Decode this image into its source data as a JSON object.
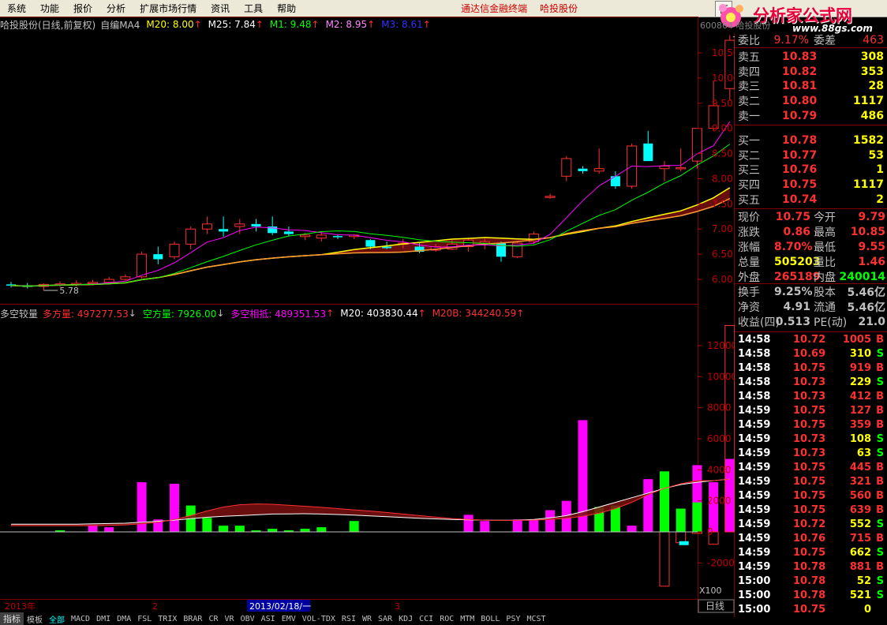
{
  "menu": {
    "items": [
      "系统",
      "功能",
      "报价",
      "分析",
      "扩展市场行情",
      "资讯",
      "工具",
      "帮助"
    ],
    "brand_left": "通达信金融终端",
    "brand_right": "哈投股份",
    "right_tab": "行"
  },
  "logo": {
    "text": "分析家公式网",
    "url": "www.88gs.com"
  },
  "chart_title": {
    "stock": "哈投股份(日线,前复权)",
    "indicator": "自编MA4",
    "m20": "M20: 8.00",
    "m25": "M25: 7.84",
    "m1": "M1: 9.48",
    "m2": "M2: 8.95",
    "m3": "M3: 8.61",
    "code_overlay": "600864 哈投股份"
  },
  "price_axis": [
    "10.50",
    "10.00",
    "9.50",
    "9.00",
    "8.50",
    "8.00",
    "7.50",
    "7.00",
    "6.50",
    "6.00"
  ],
  "high_label": "10.85",
  "low_label": "5.78",
  "volume_title": {
    "name": "多空较量",
    "long": "多方量: 497277.53",
    "short": "空方量: 7926.00",
    "diff": "多空相抵: 489351.53",
    "m20": "M20: 403830.44",
    "m20b": "M20B: 344240.59"
  },
  "volume_axis": [
    "12000",
    "10000",
    "8000",
    "6000",
    "4000",
    "2000",
    "0",
    "-2000"
  ],
  "volume_unit": "X100",
  "period": "日线",
  "x_axis": {
    "year": "2013年",
    "feb": "2",
    "cursor_date": "2013/02/18/一",
    "mar": "3"
  },
  "bottom_tabs": [
    "指标",
    "模板",
    "全部",
    "MACD",
    "DMI",
    "DMA",
    "FSL",
    "TRIX",
    "BRAR",
    "CR",
    "VR",
    "OBV",
    "ASI",
    "EMV",
    "VOL-TDX",
    "RSI",
    "WR",
    "SAR",
    "KDJ",
    "CCI",
    "ROC",
    "MTM",
    "BOLL",
    "PSY",
    "MCST"
  ],
  "colors": {
    "up": "#ff3030",
    "down": "#00ffff",
    "long": "#ff00ff",
    "short": "#00ff00",
    "text": "#c0c0c0",
    "yellow": "#ffff00"
  },
  "quote": {
    "weibi": {
      "label": "委比",
      "value": "9.17%"
    },
    "weicha": {
      "label": "委差",
      "value": "463"
    },
    "sell": [
      {
        "label": "卖五",
        "price": "10.83",
        "vol": "308"
      },
      {
        "label": "卖四",
        "price": "10.82",
        "vol": "353"
      },
      {
        "label": "卖三",
        "price": "10.81",
        "vol": "28"
      },
      {
        "label": "卖二",
        "price": "10.80",
        "vol": "1117"
      },
      {
        "label": "卖一",
        "price": "10.79",
        "vol": "486"
      }
    ],
    "buy": [
      {
        "label": "买一",
        "price": "10.78",
        "vol": "1582"
      },
      {
        "label": "买二",
        "price": "10.77",
        "vol": "53"
      },
      {
        "label": "买三",
        "price": "10.76",
        "vol": "1"
      },
      {
        "label": "买四",
        "price": "10.75",
        "vol": "1117"
      },
      {
        "label": "买五",
        "price": "10.74",
        "vol": "2"
      }
    ],
    "stats": [
      {
        "l1": "现价",
        "v1": "10.75",
        "l2": "今开",
        "v2": "9.79",
        "c1": "#ff3030",
        "c2": "#ff3030"
      },
      {
        "l1": "涨跌",
        "v1": "0.86",
        "l2": "最高",
        "v2": "10.85",
        "c1": "#ff3030",
        "c2": "#ff3030"
      },
      {
        "l1": "涨幅",
        "v1": "8.70%",
        "l2": "最低",
        "v2": "9.55",
        "c1": "#ff3030",
        "c2": "#ff3030"
      },
      {
        "l1": "总量",
        "v1": "505203",
        "l2": "量比",
        "v2": "1.46",
        "c1": "#ffff00",
        "c2": "#ff3030"
      },
      {
        "l1": "外盘",
        "v1": "265189",
        "l2": "内盘",
        "v2": "240014",
        "c1": "#ff3030",
        "c2": "#00ff00"
      },
      {
        "l1": "换手",
        "v1": "9.25%",
        "l2": "股本",
        "v2": "5.46亿",
        "c1": "#c0c0c0",
        "c2": "#c0c0c0"
      },
      {
        "l1": "净资",
        "v1": "4.91",
        "l2": "流通",
        "v2": "5.46亿",
        "c1": "#c0c0c0",
        "c2": "#c0c0c0"
      },
      {
        "l1": "收益(四)",
        "v1": "0.513",
        "l2": "PE(动)",
        "v2": "21.0",
        "c1": "#c0c0c0",
        "c2": "#c0c0c0"
      }
    ],
    "ticks": [
      {
        "time": "14:58",
        "price": "10.72",
        "vol": "1005",
        "bs": "B"
      },
      {
        "time": "14:58",
        "price": "10.69",
        "vol": "310",
        "bs": "S"
      },
      {
        "time": "14:58",
        "price": "10.75",
        "vol": "919",
        "bs": "B"
      },
      {
        "time": "14:58",
        "price": "10.73",
        "vol": "229",
        "bs": "S"
      },
      {
        "time": "14:58",
        "price": "10.73",
        "vol": "412",
        "bs": "B"
      },
      {
        "time": "14:59",
        "price": "10.75",
        "vol": "127",
        "bs": "B"
      },
      {
        "time": "14:59",
        "price": "10.75",
        "vol": "359",
        "bs": "B"
      },
      {
        "time": "14:59",
        "price": "10.73",
        "vol": "108",
        "bs": "S"
      },
      {
        "time": "14:59",
        "price": "10.73",
        "vol": "63",
        "bs": "S"
      },
      {
        "time": "14:59",
        "price": "10.75",
        "vol": "445",
        "bs": "B"
      },
      {
        "time": "14:59",
        "price": "10.75",
        "vol": "321",
        "bs": "B"
      },
      {
        "time": "14:59",
        "price": "10.75",
        "vol": "560",
        "bs": "B"
      },
      {
        "time": "14:59",
        "price": "10.75",
        "vol": "639",
        "bs": "B"
      },
      {
        "time": "14:59",
        "price": "10.72",
        "vol": "552",
        "bs": "S"
      },
      {
        "time": "14:59",
        "price": "10.76",
        "vol": "715",
        "bs": "B"
      },
      {
        "time": "14:59",
        "price": "10.75",
        "vol": "662",
        "bs": "S"
      },
      {
        "time": "14:59",
        "price": "10.78",
        "vol": "881",
        "bs": "B"
      },
      {
        "time": "15:00",
        "price": "10.78",
        "vol": "52",
        "bs": "S"
      },
      {
        "time": "15:00",
        "price": "10.78",
        "vol": "521",
        "bs": "S"
      },
      {
        "time": "15:00",
        "price": "10.75",
        "vol": "0",
        "bs": ""
      }
    ]
  },
  "chart_data": [
    {
      "type": "candlestick",
      "title": "哈投股份(日线,前复权)",
      "ylim": [
        5.78,
        10.85
      ],
      "ohlc": [
        [
          5.9,
          5.95,
          5.84,
          5.88
        ],
        [
          5.88,
          5.93,
          5.82,
          5.85
        ],
        [
          5.86,
          5.92,
          5.78,
          5.9
        ],
        [
          5.9,
          5.96,
          5.85,
          5.91
        ],
        [
          5.91,
          5.98,
          5.86,
          5.92
        ],
        [
          5.92,
          5.99,
          5.88,
          5.94
        ],
        [
          5.94,
          6.05,
          5.9,
          6.0
        ],
        [
          6.0,
          6.1,
          5.98,
          6.05
        ],
        [
          6.05,
          6.55,
          6.02,
          6.5
        ],
        [
          6.5,
          6.65,
          6.3,
          6.4
        ],
        [
          6.45,
          6.75,
          6.4,
          6.7
        ],
        [
          6.7,
          7.05,
          6.6,
          7.0
        ],
        [
          7.0,
          7.25,
          6.9,
          7.1
        ],
        [
          7.0,
          7.25,
          6.85,
          6.95
        ],
        [
          7.05,
          7.2,
          6.9,
          7.1
        ],
        [
          7.1,
          7.2,
          6.95,
          7.05
        ],
        [
          7.05,
          7.25,
          6.88,
          6.92
        ],
        [
          6.95,
          7.05,
          6.85,
          6.9
        ],
        [
          6.85,
          6.92,
          6.78,
          6.88
        ],
        [
          6.82,
          6.95,
          6.75,
          6.88
        ],
        [
          6.86,
          6.9,
          6.8,
          6.85
        ],
        [
          6.85,
          6.9,
          6.8,
          6.88
        ],
        [
          6.78,
          6.8,
          6.6,
          6.65
        ],
        [
          6.65,
          6.75,
          6.6,
          6.62
        ],
        [
          6.7,
          6.8,
          6.62,
          6.72
        ],
        [
          6.65,
          6.72,
          6.52,
          6.55
        ],
        [
          6.58,
          6.7,
          6.55,
          6.65
        ],
        [
          6.6,
          6.78,
          6.58,
          6.7
        ],
        [
          6.65,
          6.82,
          6.55,
          6.78
        ],
        [
          6.72,
          6.8,
          6.6,
          6.75
        ],
        [
          6.72,
          6.75,
          6.35,
          6.45
        ],
        [
          6.45,
          6.75,
          6.42,
          6.72
        ],
        [
          6.75,
          6.95,
          6.7,
          6.9
        ],
        [
          7.65,
          7.7,
          7.6,
          7.65
        ],
        [
          8.05,
          8.45,
          7.95,
          8.4
        ],
        [
          8.2,
          8.25,
          8.1,
          8.15
        ],
        [
          8.15,
          8.6,
          8.1,
          8.2
        ],
        [
          8.05,
          8.15,
          7.8,
          7.85
        ],
        [
          7.85,
          8.7,
          7.8,
          8.65
        ],
        [
          8.7,
          8.95,
          8.4,
          8.35
        ],
        [
          8.2,
          8.35,
          7.95,
          8.25
        ],
        [
          8.2,
          8.6,
          8.15,
          8.22
        ],
        [
          8.35,
          9.0,
          8.2,
          9.0
        ],
        [
          9.0,
          9.95,
          8.95,
          9.45
        ],
        [
          9.79,
          10.85,
          9.55,
          10.75
        ]
      ],
      "ma": {
        "M20": "8.00",
        "M25": "7.84",
        "M1": "9.48",
        "M2": "8.95",
        "M3": "8.61"
      }
    },
    {
      "type": "bar",
      "title": "多空较量",
      "unit": "X100",
      "ylim": [
        -3500,
        13500
      ],
      "series": [
        {
          "name": "多方量",
          "values": [
            0,
            0,
            0,
            0,
            0,
            500,
            300,
            0,
            3200,
            800,
            3100,
            0,
            0,
            0,
            0,
            0,
            0,
            0,
            0,
            0,
            0,
            0,
            0,
            0,
            0,
            0,
            0,
            0,
            1100,
            700,
            0,
            800,
            800,
            1400,
            2000,
            7200,
            0,
            0,
            400,
            3400,
            0,
            0,
            4300,
            3200,
            4700
          ]
        },
        {
          "name": "空方量",
          "values": [
            0,
            0,
            0,
            100,
            0,
            0,
            0,
            0,
            0,
            0,
            0,
            1700,
            900,
            400,
            400,
            100,
            200,
            100,
            200,
            300,
            0,
            700,
            0,
            0,
            0,
            0,
            0,
            0,
            0,
            0,
            0,
            0,
            0,
            0,
            0,
            0,
            1600,
            1700,
            0,
            0,
            3900,
            1500,
            1900,
            0,
            0
          ]
        },
        {
          "name": "下方",
          "values": [
            0,
            0,
            0,
            0,
            0,
            0,
            0,
            0,
            0,
            0,
            0,
            0,
            0,
            0,
            0,
            0,
            0,
            0,
            0,
            0,
            0,
            0,
            0,
            0,
            0,
            0,
            0,
            0,
            0,
            0,
            0,
            0,
            0,
            0,
            0,
            0,
            0,
            0,
            0,
            0,
            -3500,
            -700,
            -100,
            -800,
            0
          ]
        },
        {
          "name": "M20",
          "values": [
            500,
            500,
            500,
            500,
            500,
            520,
            540,
            560,
            620,
            680,
            760,
            850,
            940,
            1000,
            1050,
            1100,
            1150,
            1160,
            1170,
            1150,
            1120,
            1080,
            1030,
            980,
            930,
            880,
            840,
            800,
            780,
            760,
            750,
            760,
            800,
            900,
            1050,
            1300,
            1600,
            1900,
            2200,
            2500,
            2800,
            3050,
            3200,
            3300,
            3400
          ]
        },
        {
          "name": "M20B",
          "values": [
            400,
            400,
            400,
            400,
            400,
            400,
            420,
            450,
            520,
            620,
            800,
            1050,
            1350,
            1600,
            1750,
            1800,
            1780,
            1720,
            1650,
            1580,
            1500,
            1420,
            1340,
            1250,
            1150,
            1050,
            950,
            860,
            800,
            760,
            740,
            740,
            760,
            800,
            880,
            1000,
            1200,
            1500,
            1900,
            2400,
            2800,
            3100,
            3300,
            3300,
            3400
          ]
        }
      ],
      "last_hollow_bar_value": 13300
    }
  ]
}
